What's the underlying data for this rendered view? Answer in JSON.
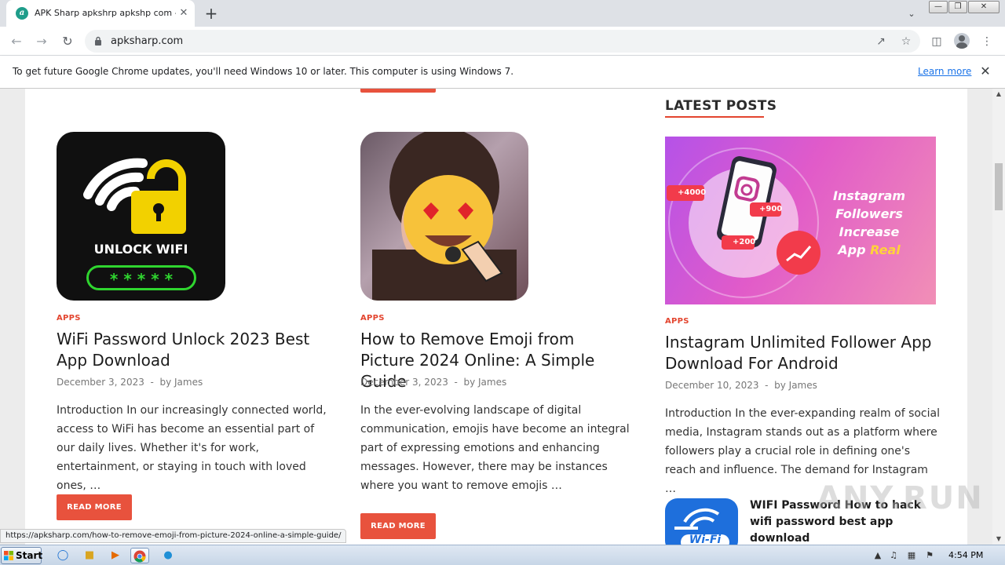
{
  "browser": {
    "tab_title": "APK Sharp apkshrp apkshp com - Yo",
    "tab_close": "✕",
    "new_tab": "+",
    "url": "apksharp.com",
    "status_url": "https://apksharp.com/how-to-remove-emoji-from-picture-2024-online-a-simple-guide/"
  },
  "infobar": {
    "message": "To get future Google Chrome updates, you'll need Windows 10 or later. This computer is using Windows 7.",
    "learn_more": "Learn more"
  },
  "posts": [
    {
      "category": "APPS",
      "title": "WiFi Password Unlock 2023 Best App Download",
      "date": "December 3, 2023",
      "author_prefix": "by",
      "author": "James",
      "excerpt": "Introduction In our increasingly connected world, access to WiFi has become an essential part of our daily lives. Whether it's for work, entertainment, or staying in touch with loved ones, …",
      "read_more": "READ MORE",
      "thumb_text": "UNLOCK WIFI",
      "thumb_stars": "* * * * *"
    },
    {
      "category": "APPS",
      "title": "How to Remove Emoji from Picture 2024 Online: A Simple Guide",
      "date": "December 3, 2023",
      "author_prefix": "by",
      "author": "James",
      "excerpt": "In the ever-evolving landscape of digital communication, emojis have become an integral part of expressing emotions and enhancing messages. However, there may be instances where you want to remove emojis …",
      "read_more": "READ MORE"
    }
  ],
  "sidebar": {
    "heading": "LATEST POSTS",
    "featured": {
      "category": "APPS",
      "title": "Instagram Unlimited Follower App Download For Android",
      "date": "December 10, 2023",
      "author_prefix": "by",
      "author": "James",
      "excerpt": "Introduction In the ever-expanding realm of social media, Instagram stands out as a platform where followers play a crucial role in defining one's reach and influence. The demand for Instagram …",
      "banner_line1": "Instagram",
      "banner_line2": "Followers Increase",
      "banner_line3a": "App ",
      "banner_line3b": "Real",
      "badge1": "+4000",
      "badge2": "+900",
      "badge3": "+200"
    },
    "small_post": {
      "title": "WIFI Password How to hack wifi password best app download",
      "thumb_text": "Wi-Fi"
    }
  },
  "watermark": "ANY.RUN",
  "taskbar": {
    "start": "Start",
    "clock": "4:54 PM"
  },
  "colors": {
    "accent": "#e8523d",
    "category": "#e3452f",
    "link": "#1a73e8"
  }
}
